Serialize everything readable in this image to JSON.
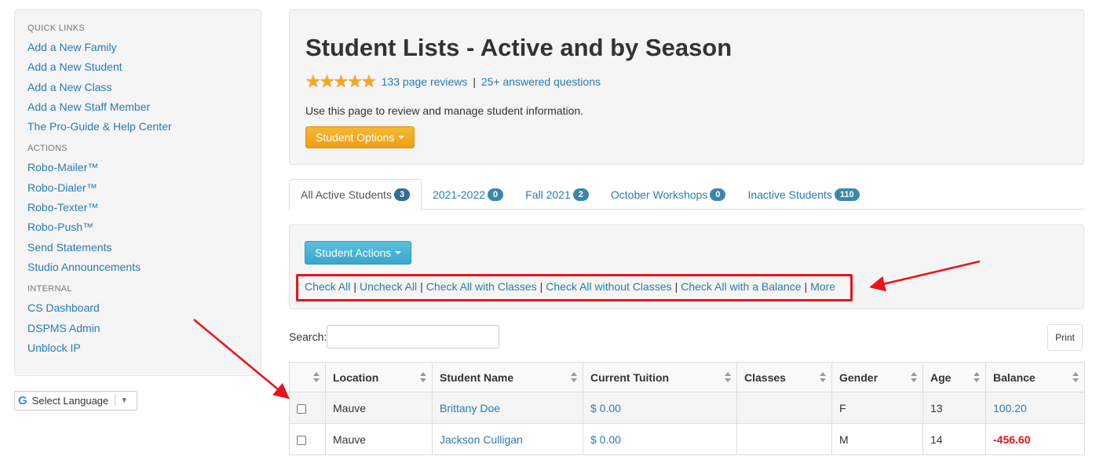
{
  "sidebar": {
    "groups": [
      {
        "heading": "QUICK LINKS",
        "links": [
          "Add a New Family",
          "Add a New Student",
          "Add a New Class",
          "Add a New Staff Member",
          "The Pro-Guide & Help Center"
        ]
      },
      {
        "heading": "ACTIONS",
        "links": [
          "Robo-Mailer™",
          "Robo-Dialer™",
          "Robo-Texter™",
          "Robo-Push™",
          "Send Statements",
          "Studio Announcements"
        ]
      },
      {
        "heading": "INTERNAL",
        "links": [
          "CS Dashboard",
          "DSPMS Admin",
          "Unblock IP"
        ]
      }
    ]
  },
  "language": {
    "logo": "G",
    "label": "Select Language",
    "arrow": "▼"
  },
  "header": {
    "title": "Student Lists - Active and by Season",
    "rating_stars": 5,
    "reviews_link": "133 page reviews",
    "separator": "|",
    "questions_link": "25+ answered questions",
    "description": "Use this page to review and manage student information.",
    "options_button": "Student Options"
  },
  "tabs": [
    {
      "label": "All Active Students",
      "count": "3",
      "active": true
    },
    {
      "label": "2021-2022",
      "count": "0",
      "active": false
    },
    {
      "label": "Fall 2021",
      "count": "2",
      "active": false
    },
    {
      "label": "October Workshops",
      "count": "0",
      "active": false
    },
    {
      "label": "Inactive Students",
      "count": "110",
      "active": false
    }
  ],
  "actions": {
    "button": "Student Actions",
    "links": [
      "Check All",
      "Uncheck All",
      "Check All with Classes",
      "Check All without Classes",
      "Check All with a Balance",
      "More"
    ],
    "separator": "|"
  },
  "search": {
    "label": "Search:",
    "value": ""
  },
  "print_button": "Print",
  "table": {
    "columns": [
      "",
      "Location",
      "Student Name",
      "Current Tuition",
      "Classes",
      "Gender",
      "Age",
      "Balance"
    ],
    "rows": [
      {
        "location": "Mauve",
        "name": "Brittany Doe",
        "tuition": "$ 0.00",
        "classes": "",
        "gender": "F",
        "age": "13",
        "balance": "100.20",
        "negative": false
      },
      {
        "location": "Mauve",
        "name": "Jackson Culligan",
        "tuition": "$ 0.00",
        "classes": "",
        "gender": "M",
        "age": "14",
        "balance": "-456.60",
        "negative": true
      }
    ]
  },
  "colors": {
    "link": "#2a7ab8",
    "orange_button": "#f0ad1f",
    "blue_button": "#5bc0de",
    "badge": "#3a87ad",
    "annotation_red": "#e8141c",
    "negative_balance": "#e0141c"
  }
}
